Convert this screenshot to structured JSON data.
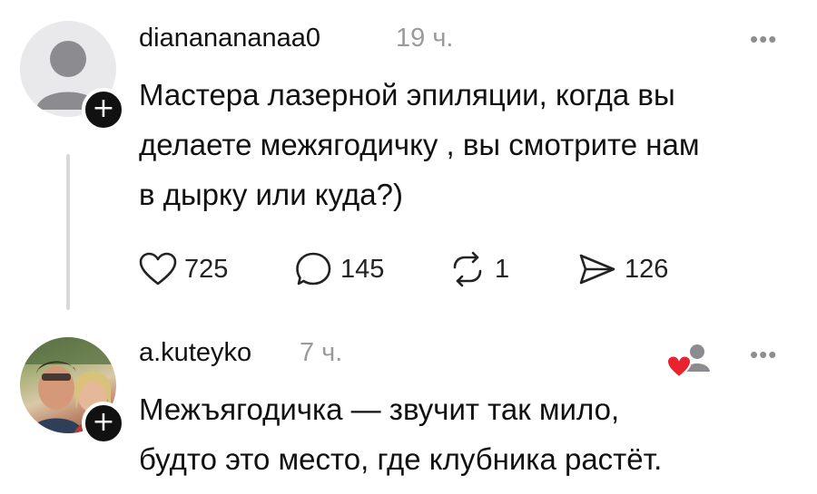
{
  "comments": [
    {
      "username": "diananananaa0",
      "time": "19 ч.",
      "text_lines": [
        "Мастера лазерной эпиляции, когда вы",
        "делаете межягодичку , вы смотрите нам",
        "в дырку или куда?)"
      ],
      "likes": "725",
      "replies": "145",
      "reposts": "1",
      "shares": "126",
      "more": "•••"
    },
    {
      "username": "a.kuteyko",
      "time": "7 ч.",
      "text_lines": [
        "Межъягодичка — звучит так мило,",
        "будто это место, где клубника растёт."
      ],
      "more": "•••"
    }
  ],
  "icons": {
    "plus_glyph": "+",
    "heart_color": "#e8232f"
  }
}
